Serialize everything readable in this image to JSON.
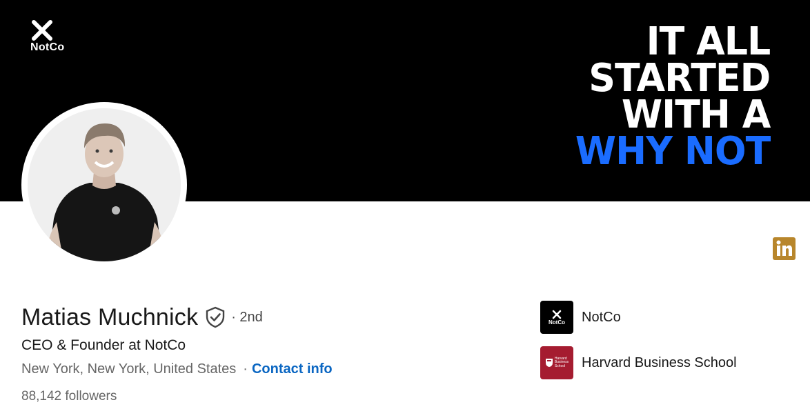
{
  "banner": {
    "brand_name": "NotCo",
    "slogan_lines": [
      "IT ALL",
      "STARTED",
      "WITH A",
      "WHY NOT"
    ],
    "colors": {
      "background": "#000000",
      "text": "#ffffff",
      "accent": "#1a6cff"
    }
  },
  "profile": {
    "name": "Matias Muchnick",
    "verified_icon": "shield-check-icon",
    "degree": "· 2nd",
    "headline": "CEO & Founder at NotCo",
    "location": "New York, New York, United States",
    "separator": "·",
    "contact_label": "Contact info",
    "followers": "88,142 followers"
  },
  "linkedin_badge": {
    "icon": "linkedin-icon",
    "color": "#b8862b"
  },
  "organizations": [
    {
      "name": "NotCo",
      "logo_text": "NotCo",
      "logo_bg": "#000000"
    },
    {
      "name": "Harvard Business School",
      "logo_text": [
        "Harvard",
        "Business",
        "School"
      ],
      "logo_bg": "#a51c30"
    }
  ],
  "colors": {
    "link": "#0a66c2",
    "muted_text": "#666666"
  }
}
